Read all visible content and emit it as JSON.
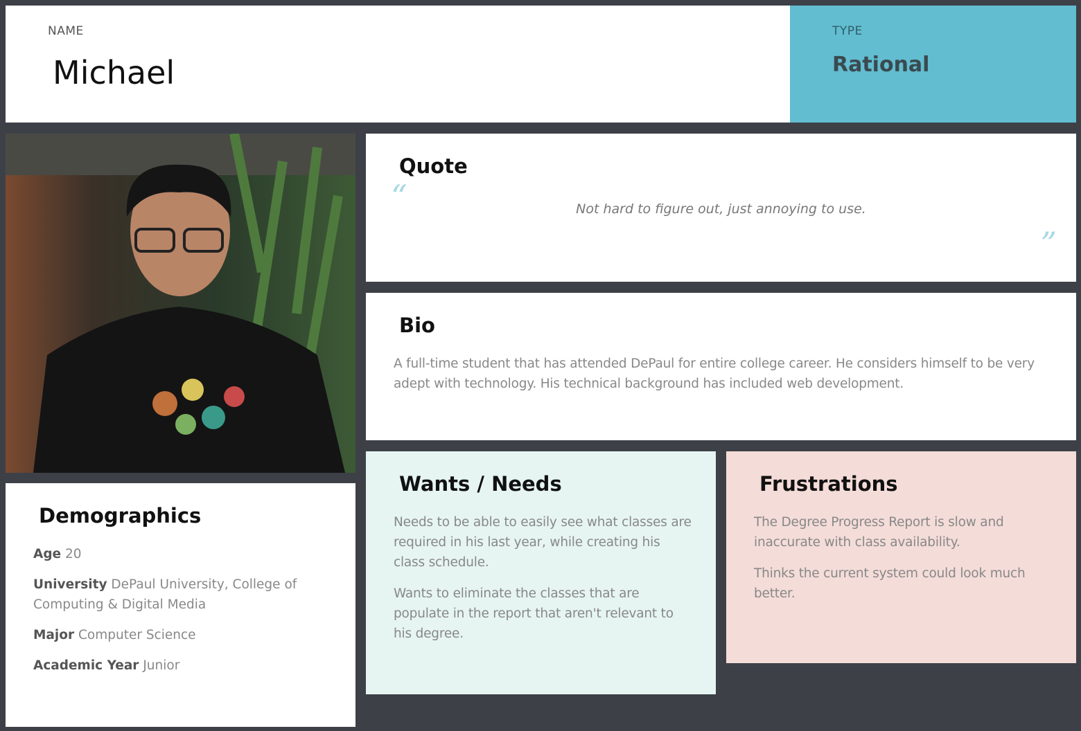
{
  "header": {
    "name_label": "NAME",
    "name": "Michael",
    "type_label": "TYPE",
    "type": "Rational"
  },
  "photo": {
    "alt": "portrait photo"
  },
  "quote": {
    "title": "Quote",
    "open_mark": "“",
    "text": "Not hard to figure out, just annoying to use.",
    "close_mark": "”"
  },
  "bio": {
    "title": "Bio",
    "text": "A full-time student that has attended DePaul for entire college career. He considers himself to be very adept with technology. His technical background has included web development."
  },
  "demographics": {
    "title": "Demographics",
    "rows": [
      {
        "label": "Age",
        "value": "20"
      },
      {
        "label": "University",
        "value": "DePaul University, College of Computing & Digital Media"
      },
      {
        "label": "Major",
        "value": "Computer Science"
      },
      {
        "label": "Academic Year",
        "value": "Junior"
      }
    ]
  },
  "wants": {
    "title": "Wants / Needs",
    "items": [
      "Needs to be able to easily see what classes are required in his last year, while creating his class schedule.",
      "Wants to eliminate the classes that are populate in the report that aren't relevant to his degree."
    ]
  },
  "frustrations": {
    "title": "Frustrations",
    "items": [
      "The Degree Progress Report is slow and inaccurate with class availability.",
      "Thinks the current system could look much better."
    ]
  },
  "colors": {
    "background": "#3d4047",
    "type_panel": "#62bdd0",
    "wants_panel": "#e6f5f2",
    "frustrations_panel": "#f4dcd8",
    "quote_marks": "#a8d8e4"
  }
}
